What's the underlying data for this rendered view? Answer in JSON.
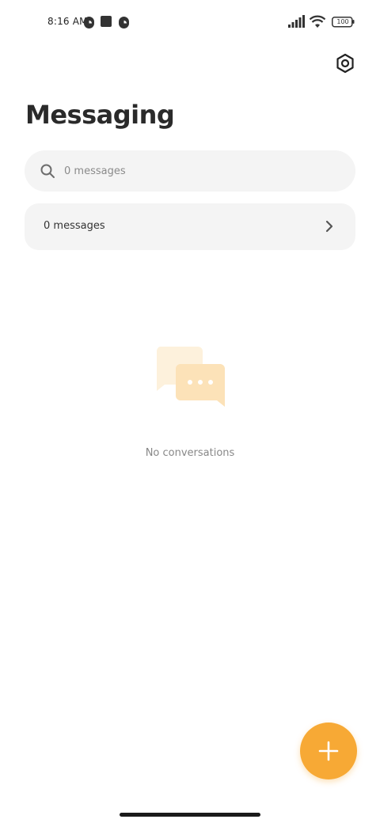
{
  "status_bar": {
    "time": "8:16 AM",
    "battery": "100",
    "icons": [
      "notification-circle-icon",
      "square-app-icon",
      "notification-circle-icon",
      "signal-icon",
      "wifi-icon",
      "battery-icon"
    ]
  },
  "header": {
    "title": "Messaging",
    "settings_icon": "settings-hexagon-icon"
  },
  "search": {
    "placeholder": "0 messages",
    "value": ""
  },
  "messages_row": {
    "label": "0 messages",
    "icon": "chevron-right-icon"
  },
  "empty_state": {
    "icon": "chat-bubbles-icon",
    "text": "No conversations"
  },
  "fab": {
    "icon": "plus-icon",
    "color": "#f7a935"
  },
  "colors": {
    "accent": "#f7a935",
    "surface": "#f4f4f4",
    "illustration_light": "#fdf1dc",
    "illustration_mid": "#fce2b8"
  }
}
